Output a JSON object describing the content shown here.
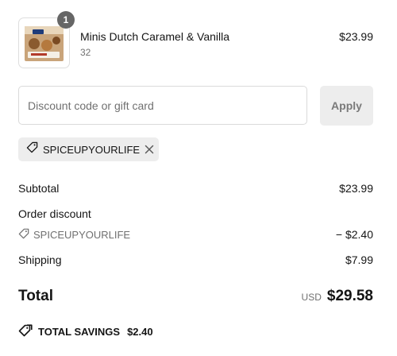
{
  "product": {
    "name": "Minis Dutch Caramel & Vanilla",
    "variant": "32",
    "price": "$23.99",
    "quantity": "1"
  },
  "discount": {
    "placeholder": "Discount code or gift card",
    "value": "",
    "apply_label": "Apply",
    "applied_code": "SPICEUPYOURLIFE"
  },
  "summary": {
    "subtotal_label": "Subtotal",
    "subtotal_value": "$23.99",
    "order_discount_label": "Order discount",
    "order_discount_code": "SPICEUPYOURLIFE",
    "order_discount_value": "− $2.40",
    "shipping_label": "Shipping",
    "shipping_value": "$7.99",
    "total_label": "Total",
    "total_currency": "USD",
    "total_value": "$29.58",
    "savings_label": "TOTAL SAVINGS",
    "savings_value": "$2.40"
  },
  "icons": {
    "tag": "tag-icon",
    "close": "close-icon",
    "savings": "savings-tag-icon"
  },
  "colors": {
    "text": "#141414",
    "muted": "#707070",
    "badge": "#666666",
    "chip_bg": "#ededed"
  }
}
